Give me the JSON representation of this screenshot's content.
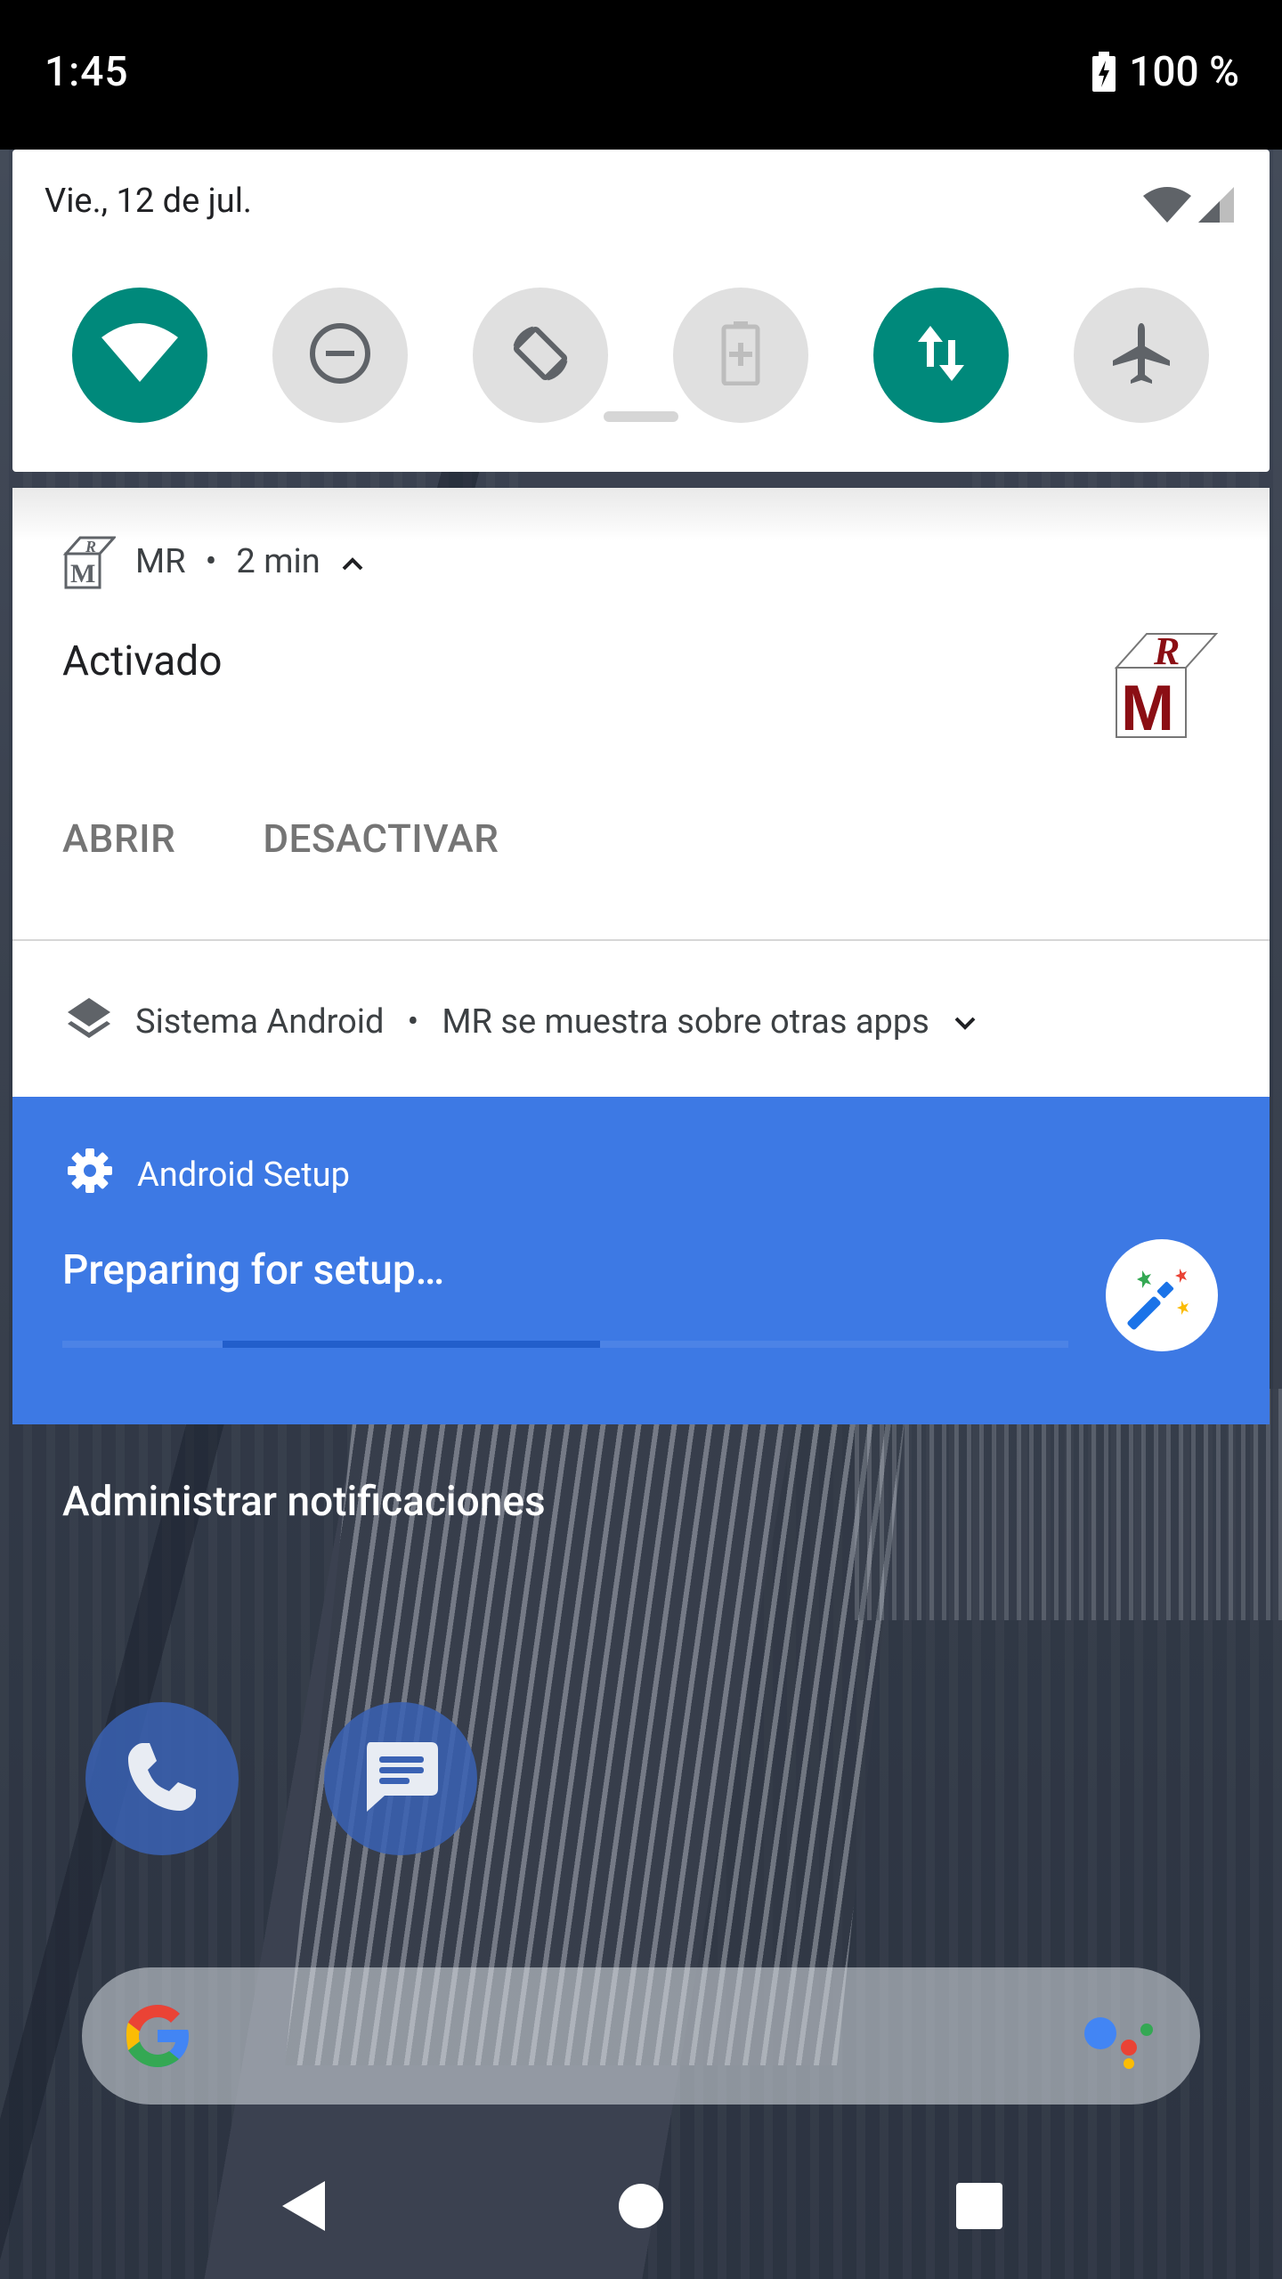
{
  "status_bar": {
    "time": "1:45",
    "battery": "100 %"
  },
  "quick_settings": {
    "date": "Vie., 12 de jul.",
    "tiles": [
      {
        "name": "wifi",
        "state": "on"
      },
      {
        "name": "do-not-disturb",
        "state": "off"
      },
      {
        "name": "auto-rotate",
        "state": "off"
      },
      {
        "name": "battery-saver",
        "state": "disabled"
      },
      {
        "name": "mobile-data",
        "state": "on"
      },
      {
        "name": "airplane-mode",
        "state": "off"
      }
    ],
    "accent": "#00897b"
  },
  "notifications": {
    "mr": {
      "app": "MR",
      "time": "2 min",
      "title": "Activado",
      "actions": [
        "ABRIR",
        "DESACTIVAR"
      ]
    },
    "system": {
      "app": "Sistema Android",
      "text": "MR se muestra sobre otras apps"
    },
    "setup": {
      "app": "Android Setup",
      "title": "Preparing for setup…",
      "color": "#3d79e4"
    }
  },
  "manage_label": "Administrar notificaciones",
  "home": {
    "dock": [
      "phone-icon",
      "messages-icon"
    ],
    "search": {
      "logo": "google-g-icon",
      "assistant": "assistant-icon"
    }
  },
  "nav": [
    "back",
    "home",
    "recents"
  ]
}
